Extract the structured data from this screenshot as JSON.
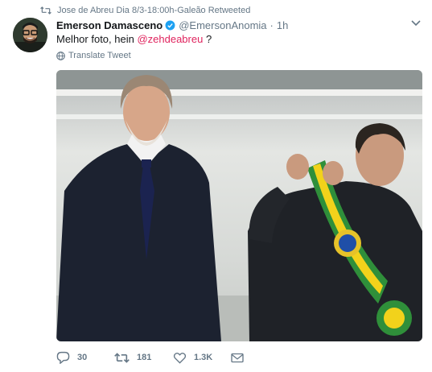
{
  "retweet": {
    "icon": "retweet-icon",
    "text": "Jose de Abreu Dia 8/3-18:00h-Galeão Retweeted"
  },
  "author": {
    "display_name": "Emerson Damasceno",
    "verified": true,
    "handle": "@EmersonAnomia",
    "separator": "·",
    "time": "1h",
    "avatar_icon": "avatar"
  },
  "tweet": {
    "text_before": "Melhor foto, hein ",
    "mention": "@zehdeabreu",
    "text_after": " ?"
  },
  "translate": {
    "icon": "globe-icon",
    "label": "Translate Tweet"
  },
  "media": {
    "type": "photo"
  },
  "actions": {
    "reply_count": "30",
    "retweet_count": "181",
    "like_count": "1.3K"
  },
  "colors": {
    "mention": "#e0245e",
    "verified": "#1da1f2",
    "muted": "#657786"
  }
}
